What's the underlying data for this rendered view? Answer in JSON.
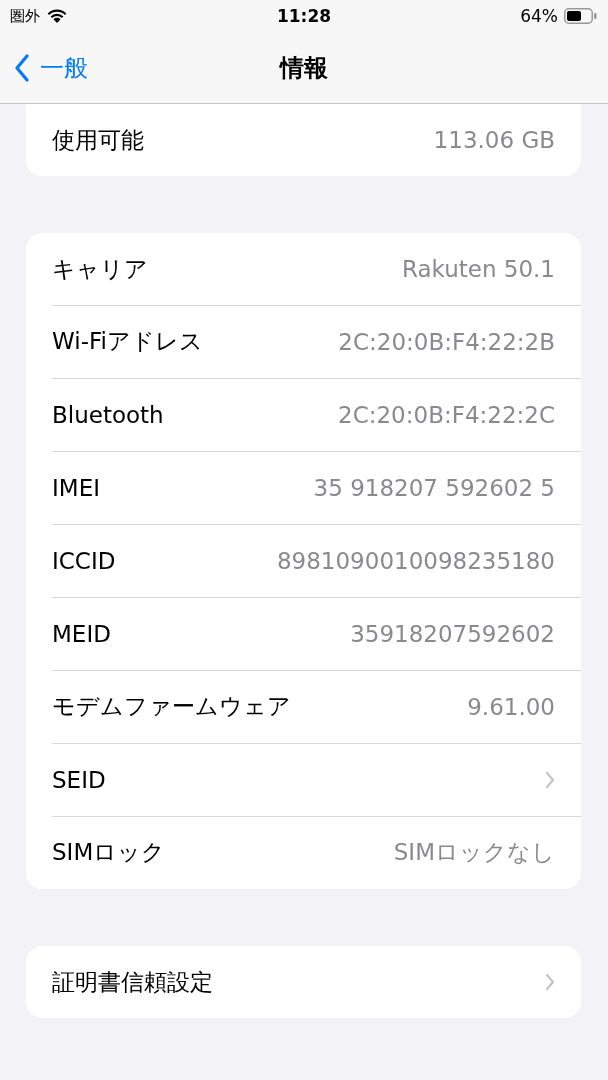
{
  "status_bar": {
    "carrier": "圏外",
    "time": "11:28",
    "battery": "64%"
  },
  "nav": {
    "back": "一般",
    "title": "情報"
  },
  "groups": [
    {
      "rows": [
        {
          "kind": "value",
          "label": "使用可能",
          "value": "113.06 GB"
        }
      ]
    },
    {
      "rows": [
        {
          "kind": "value",
          "label": "キャリア",
          "value": "Rakuten 50.1"
        },
        {
          "kind": "value",
          "label": "Wi-Fiアドレス",
          "value": "2C:20:0B:F4:22:2B"
        },
        {
          "kind": "value",
          "label": "Bluetooth",
          "value": "2C:20:0B:F4:22:2C"
        },
        {
          "kind": "value",
          "label": "IMEI",
          "value": "35 918207 592602 5"
        },
        {
          "kind": "value",
          "label": "ICCID",
          "value": "8981090010098235180"
        },
        {
          "kind": "value",
          "label": "MEID",
          "value": "35918207592602"
        },
        {
          "kind": "value",
          "label": "モデムファームウェア",
          "value": "9.61.00"
        },
        {
          "kind": "link",
          "label": "SEID"
        },
        {
          "kind": "value",
          "label": "SIMロック",
          "value": "SIMロックなし"
        }
      ]
    },
    {
      "rows": [
        {
          "kind": "link",
          "label": "証明書信頼設定"
        }
      ]
    }
  ]
}
